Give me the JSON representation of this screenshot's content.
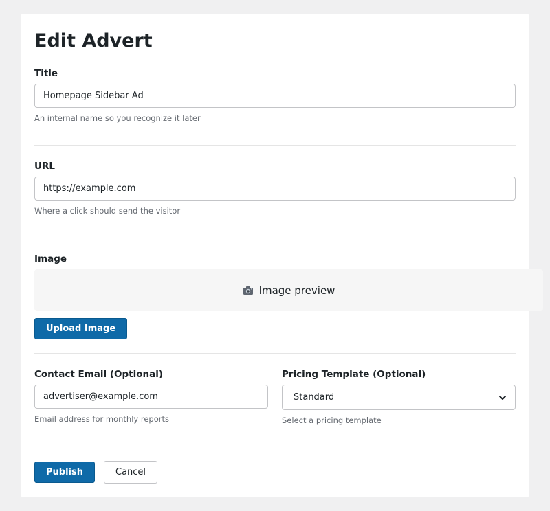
{
  "page": {
    "title": "Edit Advert"
  },
  "fields": {
    "title": {
      "label": "Title",
      "value": "Homepage Sidebar Ad",
      "help": "An internal name so you recognize it later"
    },
    "url": {
      "label": "URL",
      "value": "https://example.com",
      "help": "Where a click should send the visitor"
    },
    "image": {
      "label": "Image",
      "preview_text": "Image preview",
      "preview_icon": "camera-icon",
      "upload_label": "Upload Image"
    },
    "contact_email": {
      "label": "Contact Email (Optional)",
      "value": "advertiser@example.com",
      "help": "Email address for monthly reports"
    },
    "pricing_template": {
      "label": "Pricing Template (Optional)",
      "selected": "Standard",
      "help": "Select a pricing template"
    }
  },
  "actions": {
    "publish_label": "Publish",
    "cancel_label": "Cancel"
  },
  "colors": {
    "primary": "#0f6aa8",
    "background": "#f0f0f1",
    "card": "#ffffff"
  }
}
